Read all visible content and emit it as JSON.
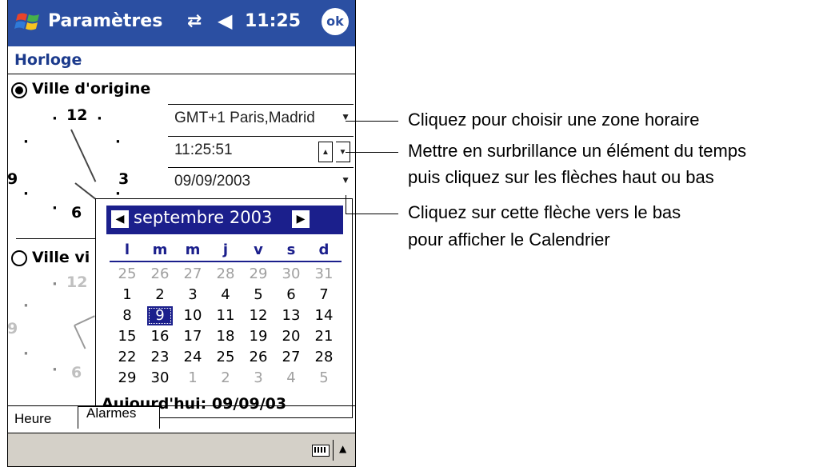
{
  "titlebar": {
    "title": "Paramètres",
    "connectivity_icon": "connectivity-icon",
    "volume_icon": "speaker-icon",
    "time": "11:25",
    "ok_label": "ok",
    "accent": "#2b4fa2"
  },
  "section_title": "Horloge",
  "home": {
    "label": "Ville d'origine",
    "timezone": "GMT+1 Paris,Madrid",
    "time": "11:25:51",
    "date": "09/09/2003"
  },
  "visiting": {
    "label": "Ville vi"
  },
  "clock_numbers": {
    "twelve": "12",
    "three": "3",
    "six": "6",
    "nine": "9"
  },
  "calendar": {
    "month_label": "septembre 2003",
    "weekdays": [
      "l",
      "m",
      "m",
      "j",
      "v",
      "s",
      "d"
    ],
    "weeks": [
      [
        "25",
        "26",
        "27",
        "28",
        "29",
        "30",
        "31"
      ],
      [
        "1",
        "2",
        "3",
        "4",
        "5",
        "6",
        "7"
      ],
      [
        "8",
        "9",
        "10",
        "11",
        "12",
        "13",
        "14"
      ],
      [
        "15",
        "16",
        "17",
        "18",
        "19",
        "20",
        "21"
      ],
      [
        "22",
        "23",
        "24",
        "25",
        "26",
        "27",
        "28"
      ],
      [
        "29",
        "30",
        "1",
        "2",
        "3",
        "4",
        "5"
      ]
    ],
    "selected": "9",
    "today_label": "Aujourd'hui: 09/09/03",
    "accent": "#1b1f8c"
  },
  "tabs": [
    {
      "label": "Heure"
    },
    {
      "label": "Alarmes"
    }
  ],
  "commandbar": {
    "keyboard_icon": "keyboard-icon",
    "sip_arrow_icon": "up-arrow-icon"
  },
  "callouts": {
    "timezone": "Cliquez pour choisir une zone horaire",
    "time_line1": "Mettre en surbrillance un élément du temps",
    "time_line2": "puis cliquez sur les flèches haut ou bas",
    "date_line1": "Cliquez sur cette flèche vers le bas",
    "date_line2": "pour afficher le Calendrier"
  }
}
